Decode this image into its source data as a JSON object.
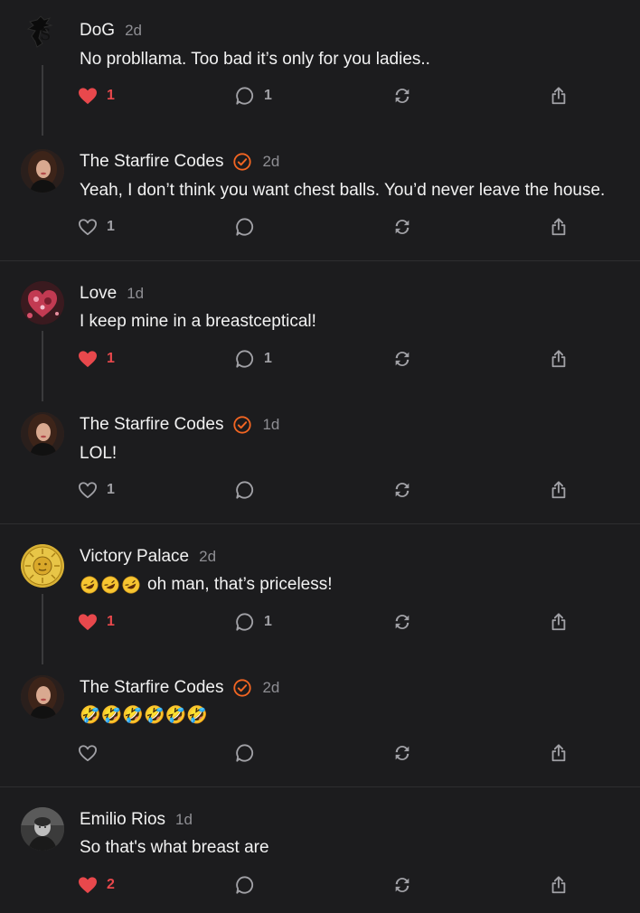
{
  "posts": [
    {
      "author": "DoG",
      "time": "2d",
      "text": "No probllama. Too bad it’s only for you ladies..",
      "likes": "1",
      "liked": true,
      "replies": "1",
      "verified": false
    },
    {
      "author": "The Starfire Codes",
      "time": "2d",
      "text": "Yeah, I don’t think you want chest balls. You’d never leave the house.",
      "likes": "1",
      "liked": false,
      "replies": "",
      "verified": true
    },
    {
      "author": "Love",
      "time": "1d",
      "text": "I keep mine in a breastceptical!",
      "likes": "1",
      "liked": true,
      "replies": "1",
      "verified": false
    },
    {
      "author": "The Starfire Codes",
      "time": "1d",
      "text": "LOL!",
      "likes": "1",
      "liked": false,
      "replies": "",
      "verified": true
    },
    {
      "author": "Victory Palace",
      "time": "2d",
      "text": "oh man, that’s priceless!",
      "emoji_prefix": "🤣🤣🤣",
      "likes": "1",
      "liked": true,
      "replies": "1",
      "verified": false
    },
    {
      "author": "The Starfire Codes",
      "time": "2d",
      "text": "🤣🤣🤣🤣🤣🤣",
      "likes": "",
      "liked": false,
      "replies": "",
      "verified": true
    },
    {
      "author": "Emilio Rios",
      "time": "1d",
      "text": "So that's what breast are",
      "likes": "2",
      "liked": true,
      "replies": "",
      "verified": false
    }
  ],
  "icons": {
    "like": "heart-icon",
    "reply": "comment-icon",
    "repost": "repost-icon",
    "share": "share-icon",
    "verified": "verified-badge-icon"
  },
  "colors": {
    "background": "#1c1c1e",
    "liked": "#e8484c",
    "verified": "#f26522",
    "muted": "#8e8e93"
  }
}
